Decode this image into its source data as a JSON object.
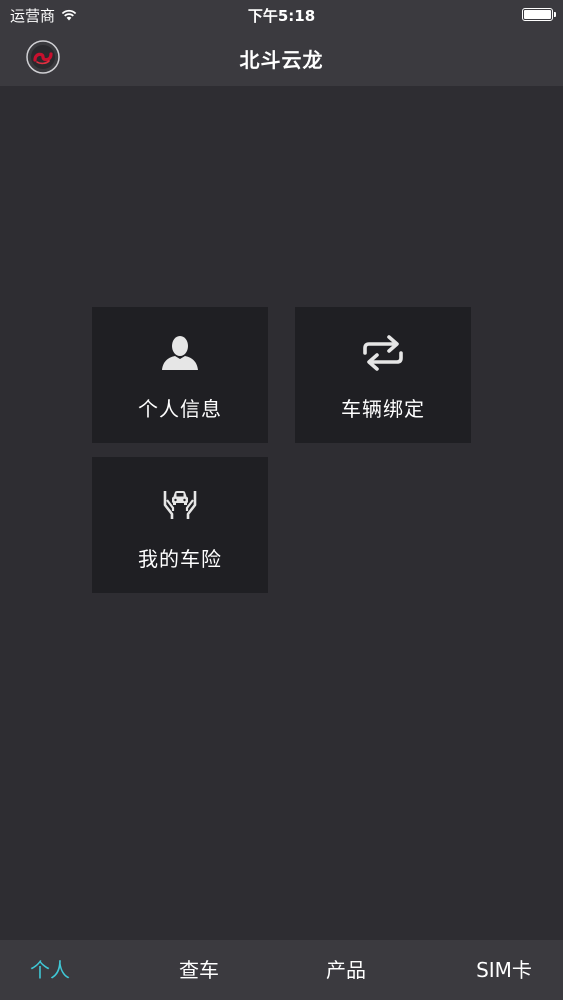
{
  "status_bar": {
    "carrier": "运营商",
    "time": "下午5:18",
    "battery_level": 1.0
  },
  "nav": {
    "title": "北斗云龙"
  },
  "tiles": [
    {
      "label": "个人信息",
      "icon": "person-icon"
    },
    {
      "label": "车辆绑定",
      "icon": "swap-arrows-icon"
    },
    {
      "label": "我的车险",
      "icon": "car-insurance-hands-icon"
    }
  ],
  "tabs": [
    {
      "label": "个人",
      "active": true
    },
    {
      "label": "查车",
      "active": false
    },
    {
      "label": "产品",
      "active": false
    },
    {
      "label": "SIM卡",
      "active": false
    }
  ],
  "colors": {
    "background": "#2e2d32",
    "bar": "#3b3a3f",
    "tile": "#1f1f23",
    "accent": "#3fc8d6",
    "logo_red": "#c8102e"
  }
}
